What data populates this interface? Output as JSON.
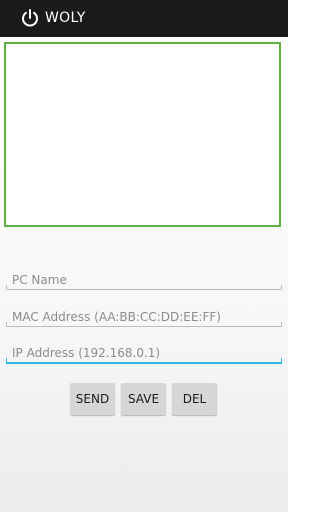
{
  "app": {
    "title": "WOLY",
    "icon": "power-icon"
  },
  "form": {
    "pc_name_placeholder": "PC Name",
    "mac_placeholder": "MAC Address (AA:BB:CC:DD:EE:FF)",
    "ip_placeholder": "IP Address (192.168.0.1)"
  },
  "buttons": {
    "send": "SEND",
    "save": "SAVE",
    "del": "DEL"
  },
  "colors": {
    "actionbar": "#1b1b1b",
    "log_border": "#5eb043",
    "focus_accent": "#33b5e5"
  }
}
